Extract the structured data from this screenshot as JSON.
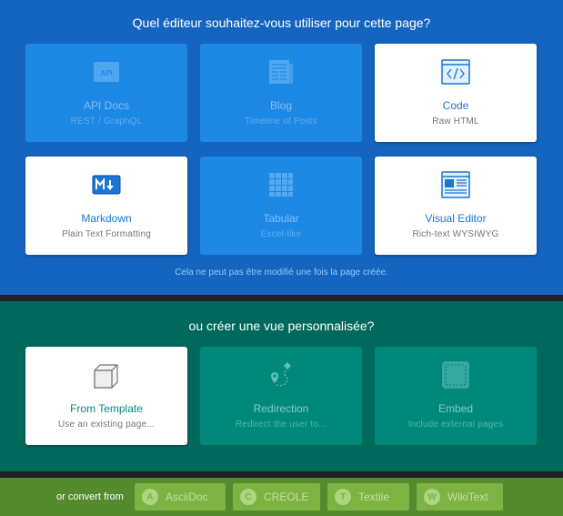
{
  "editor_section": {
    "heading": "Quel éditeur souhaitez-vous utiliser pour cette page?",
    "note": "Cela ne peut pas être modifié une fois la page créée.",
    "editors": [
      {
        "title": "API Docs",
        "subtitle": "REST / GraphQL",
        "icon": "api-icon",
        "enabled": false
      },
      {
        "title": "Blog",
        "subtitle": "Timeline of Posts",
        "icon": "newspaper-icon",
        "enabled": false
      },
      {
        "title": "Code",
        "subtitle": "Raw HTML",
        "icon": "code-window-icon",
        "enabled": true
      },
      {
        "title": "Markdown",
        "subtitle": "Plain Text Formatting",
        "icon": "markdown-icon",
        "enabled": true
      },
      {
        "title": "Tabular",
        "subtitle": "Excel-like",
        "icon": "table-grid-icon",
        "enabled": false
      },
      {
        "title": "Visual Editor",
        "subtitle": "Rich-text WYSIWYG",
        "icon": "visual-editor-icon",
        "enabled": true
      }
    ]
  },
  "custom_section": {
    "heading": "ou créer une vue personnalisée?",
    "views": [
      {
        "title": "From Template",
        "subtitle": "Use an existing page...",
        "icon": "cube-icon",
        "enabled": true
      },
      {
        "title": "Redirection",
        "subtitle": "Redirect the user to...",
        "icon": "route-pin-icon",
        "enabled": false
      },
      {
        "title": "Embed",
        "subtitle": "Include external pages",
        "icon": "embed-stamp-icon",
        "enabled": false
      }
    ]
  },
  "convert_section": {
    "label": "or convert from",
    "formats": [
      {
        "letter": "A",
        "name": "AsciiDoc"
      },
      {
        "letter": "C",
        "name": "CREOLE"
      },
      {
        "letter": "T",
        "name": "Textile"
      },
      {
        "letter": "W",
        "name": "WikiText"
      }
    ]
  },
  "colors": {
    "blue_section": "#1565c0",
    "green_section": "#00695c",
    "lime_section": "#558b2f",
    "accent_blue": "#1976d2",
    "accent_teal": "#00897b"
  }
}
